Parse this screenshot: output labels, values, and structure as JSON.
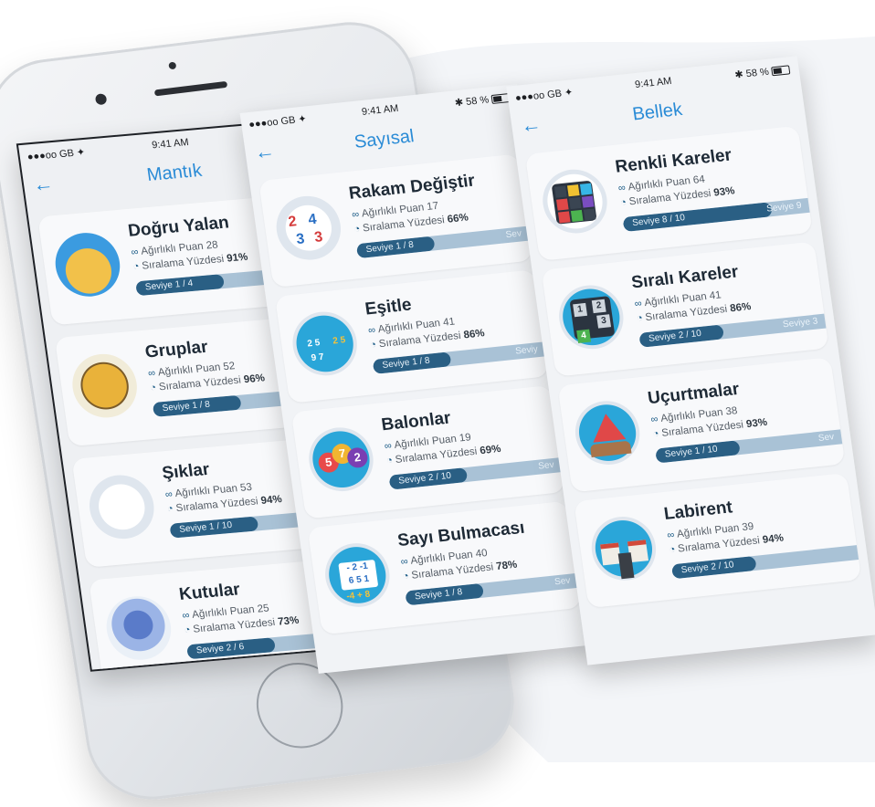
{
  "status_bar": {
    "carrier": "●●●oo GB ✦",
    "time": "9:41 AM",
    "battery": "✱ 58 %"
  },
  "screens": [
    {
      "title": "Mantık",
      "items": [
        {
          "name": "Doğru Yalan",
          "weighted": "Ağırlıklı Puan 28",
          "rank_label": "Sıralama Yüzdesi",
          "rank_value": "91%",
          "level": "Seviye 1 / 4",
          "level_fraction": 0.25
        },
        {
          "name": "Gruplar",
          "weighted": "Ağırlıklı Puan 52",
          "rank_label": "Sıralama Yüzdesi",
          "rank_value": "96%",
          "level": "Seviye 1 / 8",
          "level_fraction": 0.125
        },
        {
          "name": "Şıklar",
          "weighted": "Ağırlıklı Puan 53",
          "rank_label": "Sıralama Yüzdesi",
          "rank_value": "94%",
          "level": "Seviye 1 / 10",
          "level_fraction": 0.1
        },
        {
          "name": "Kutular",
          "weighted": "Ağırlıklı Puan 25",
          "rank_label": "Sıralama Yüzdesi",
          "rank_value": "73%",
          "level": "Seviye 2 / 6",
          "level_fraction": 0.33
        }
      ]
    },
    {
      "title": "Sayısal",
      "items": [
        {
          "name": "Rakam Değiştir",
          "weighted": "Ağırlıklı Puan 17",
          "rank_label": "Sıralama Yüzdesi",
          "rank_value": "66%",
          "level": "Seviye 1 / 8",
          "level_right": "Sev",
          "level_fraction": 0.125
        },
        {
          "name": "Eşitle",
          "weighted": "Ağırlıklı Puan 41",
          "rank_label": "Sıralama Yüzdesi",
          "rank_value": "86%",
          "level": "Seviye 1 / 8",
          "level_right": "Seviy",
          "level_fraction": 0.125
        },
        {
          "name": "Balonlar",
          "weighted": "Ağırlıklı Puan 19",
          "rank_label": "Sıralama Yüzdesi",
          "rank_value": "69%",
          "level": "Seviye 2 / 10",
          "level_right": "Sev",
          "level_fraction": 0.2
        },
        {
          "name": "Sayı Bulmacası",
          "weighted": "Ağırlıklı Puan 40",
          "rank_label": "Sıralama Yüzdesi",
          "rank_value": "78%",
          "level": "Seviye 1 / 8",
          "level_right": "Sev",
          "level_fraction": 0.125
        }
      ]
    },
    {
      "title": "Bellek",
      "items": [
        {
          "name": "Renkli Kareler",
          "weighted": "Ağırlıklı Puan 64",
          "rank_label": "Sıralama Yüzdesi",
          "rank_value": "93%",
          "level": "Seviye 8 / 10",
          "level_right": "Seviye 9",
          "level_fraction": 0.8
        },
        {
          "name": "Sıralı Kareler",
          "weighted": "Ağırlıklı Puan 41",
          "rank_label": "Sıralama Yüzdesi",
          "rank_value": "86%",
          "level": "Seviye 2 / 10",
          "level_right": "Seviye 3",
          "level_fraction": 0.2
        },
        {
          "name": "Uçurtmalar",
          "weighted": "Ağırlıklı Puan 38",
          "rank_label": "Sıralama Yüzdesi",
          "rank_value": "93%",
          "level": "Seviye 1 / 10",
          "level_right": "Sev",
          "level_fraction": 0.1
        },
        {
          "name": "Labirent",
          "weighted": "Ağırlıklı Puan 39",
          "rank_label": "Sıralama Yüzdesi",
          "rank_value": "94%",
          "level": "Seviye 2 / 10",
          "level_right": "",
          "level_fraction": 0.2
        }
      ]
    }
  ],
  "icons": {
    "back": "arrow-left-icon",
    "weighted": "infinity-icon",
    "rank": "pie-chart-icon"
  },
  "colors": {
    "accent": "#2a8bd6",
    "bar_fill": "#2a5f84",
    "bar_track": "#a9c2d6",
    "card_bg": "#f8f9fb",
    "screen_bg": "#f1f3f6"
  }
}
